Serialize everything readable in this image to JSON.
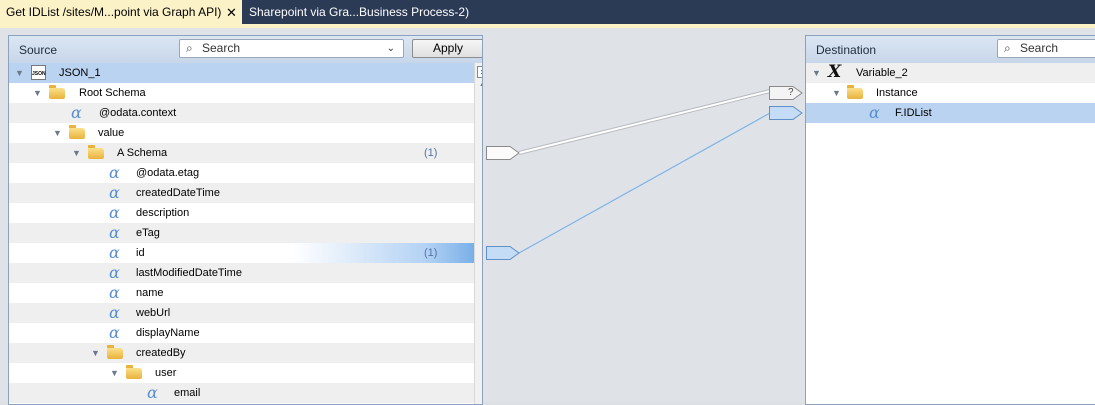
{
  "tabs": [
    {
      "label": "Get IDList /sites/M...point via Graph API)",
      "close": "✕",
      "active": true
    },
    {
      "label": "Sharepoint via Gra...Business Process-2)",
      "active": false
    }
  ],
  "source": {
    "title": "Source",
    "search_placeholder": "Search",
    "apply_label": "Apply",
    "rows": [
      {
        "label": "JSON_1"
      },
      {
        "label": "Root Schema"
      },
      {
        "label": "@odata.context"
      },
      {
        "label": "value"
      },
      {
        "label": "A Schema",
        "count": "(1)"
      },
      {
        "label": "@odata.etag"
      },
      {
        "label": "createdDateTime"
      },
      {
        "label": "description"
      },
      {
        "label": "eTag"
      },
      {
        "label": "id",
        "count": "(1)"
      },
      {
        "label": "lastModifiedDateTime"
      },
      {
        "label": "name"
      },
      {
        "label": "webUrl"
      },
      {
        "label": "displayName"
      },
      {
        "label": "createdBy"
      },
      {
        "label": "user"
      },
      {
        "label": "email"
      }
    ]
  },
  "destination": {
    "title": "Destination",
    "search_placeholder": "Search",
    "rows": [
      {
        "label": "Variable_2"
      },
      {
        "label": "Instance"
      },
      {
        "label": "F.IDList"
      }
    ]
  },
  "connector": {
    "unmapped_marker": "?"
  },
  "colors": {
    "tab_active": "#fcf2c8",
    "tab_strip": "#2b3a55",
    "selection": "#b9d3f0",
    "link_line": "#7fb3e6"
  }
}
